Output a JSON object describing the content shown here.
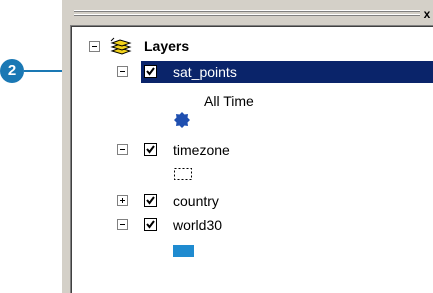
{
  "callout": {
    "number": "2"
  },
  "window": {
    "close_glyph": "x"
  },
  "toc": {
    "root_label": "Layers",
    "layers": [
      {
        "name": "sat_points",
        "checked": true,
        "expanded": true,
        "selected": true,
        "legend_label": "All Time",
        "symbol": "blue-dot"
      },
      {
        "name": "timezone",
        "checked": true,
        "expanded": true,
        "selected": false,
        "symbol": "dashed-outline"
      },
      {
        "name": "country",
        "checked": true,
        "expanded": false,
        "selected": false
      },
      {
        "name": "world30",
        "checked": true,
        "expanded": true,
        "selected": false,
        "symbol": "blue-fill"
      }
    ]
  },
  "colors": {
    "selection": "#0a246a",
    "callout": "#1a78b4",
    "symbol_dot": "#1f4fb0",
    "symbol_fill": "#1f8bd0"
  }
}
